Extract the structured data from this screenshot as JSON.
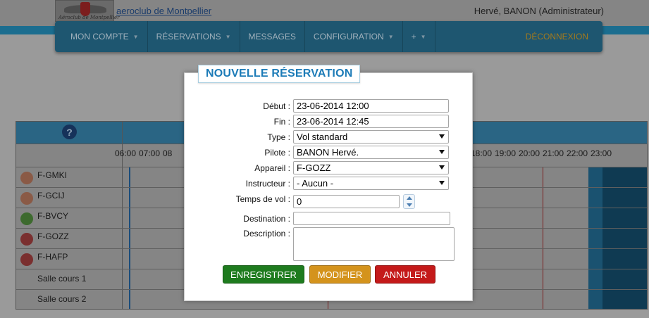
{
  "header": {
    "logo_text": "Aéroclub de Montpellier",
    "club_link": "aeroclub de Montpellier",
    "user": "Hervé, BANON (Administrateur)"
  },
  "nav": {
    "items": [
      {
        "label": "MON COMPTE",
        "has_menu": true
      },
      {
        "label": "RÉSERVATIONS",
        "has_menu": true
      },
      {
        "label": "MESSAGES",
        "has_menu": false
      },
      {
        "label": "CONFIGURATION",
        "has_menu": true
      },
      {
        "label": "+",
        "has_menu": true
      }
    ],
    "logout": "DÉCONNEXION"
  },
  "planning": {
    "help": "?",
    "hours_left": [
      "06:00",
      "07:00",
      "08"
    ],
    "hours_right": [
      "18:00",
      "19:00",
      "20:00",
      "21:00",
      "22:00",
      "23:00"
    ],
    "rows": [
      {
        "label": "F-GMKI",
        "status_color": "#8a5a46"
      },
      {
        "label": "F-GCIJ",
        "status_color": "#8a5a46"
      },
      {
        "label": "F-BVCY",
        "status_color": "#3d6a2e"
      },
      {
        "label": "F-GOZZ",
        "status_color": "#7a2f2f"
      },
      {
        "label": "F-HAFP",
        "status_color": "#7a2f2f"
      },
      {
        "label": "Salle cours 1",
        "status_color": ""
      },
      {
        "label": "Salle cours 2",
        "status_color": ""
      }
    ]
  },
  "modal": {
    "title": "NOUVELLE RÉSERVATION",
    "fields": {
      "debut": {
        "label": "Début :",
        "value": "23-06-2014 12:00"
      },
      "fin": {
        "label": "Fin :",
        "value": "23-06-2014 12:45"
      },
      "type": {
        "label": "Type :",
        "value": "Vol standard"
      },
      "pilote": {
        "label": "Pilote :",
        "value": "BANON Hervé."
      },
      "appareil": {
        "label": "Appareil :",
        "value": "F-GOZZ"
      },
      "instructeur": {
        "label": "Instructeur :",
        "value": "- Aucun -"
      },
      "temps_vol": {
        "label": "Temps de vol :",
        "value": "0"
      },
      "destination": {
        "label": "Destination :",
        "value": ""
      },
      "description": {
        "label": "Description :",
        "value": ""
      }
    },
    "buttons": {
      "save": "ENREGISTRER",
      "modify": "MODIFIER",
      "cancel": "ANNULER"
    },
    "colors": {
      "title": "#1c7bb7",
      "save": "#1e7b1e",
      "modify": "#d4931c",
      "cancel": "#c41a1a"
    }
  }
}
